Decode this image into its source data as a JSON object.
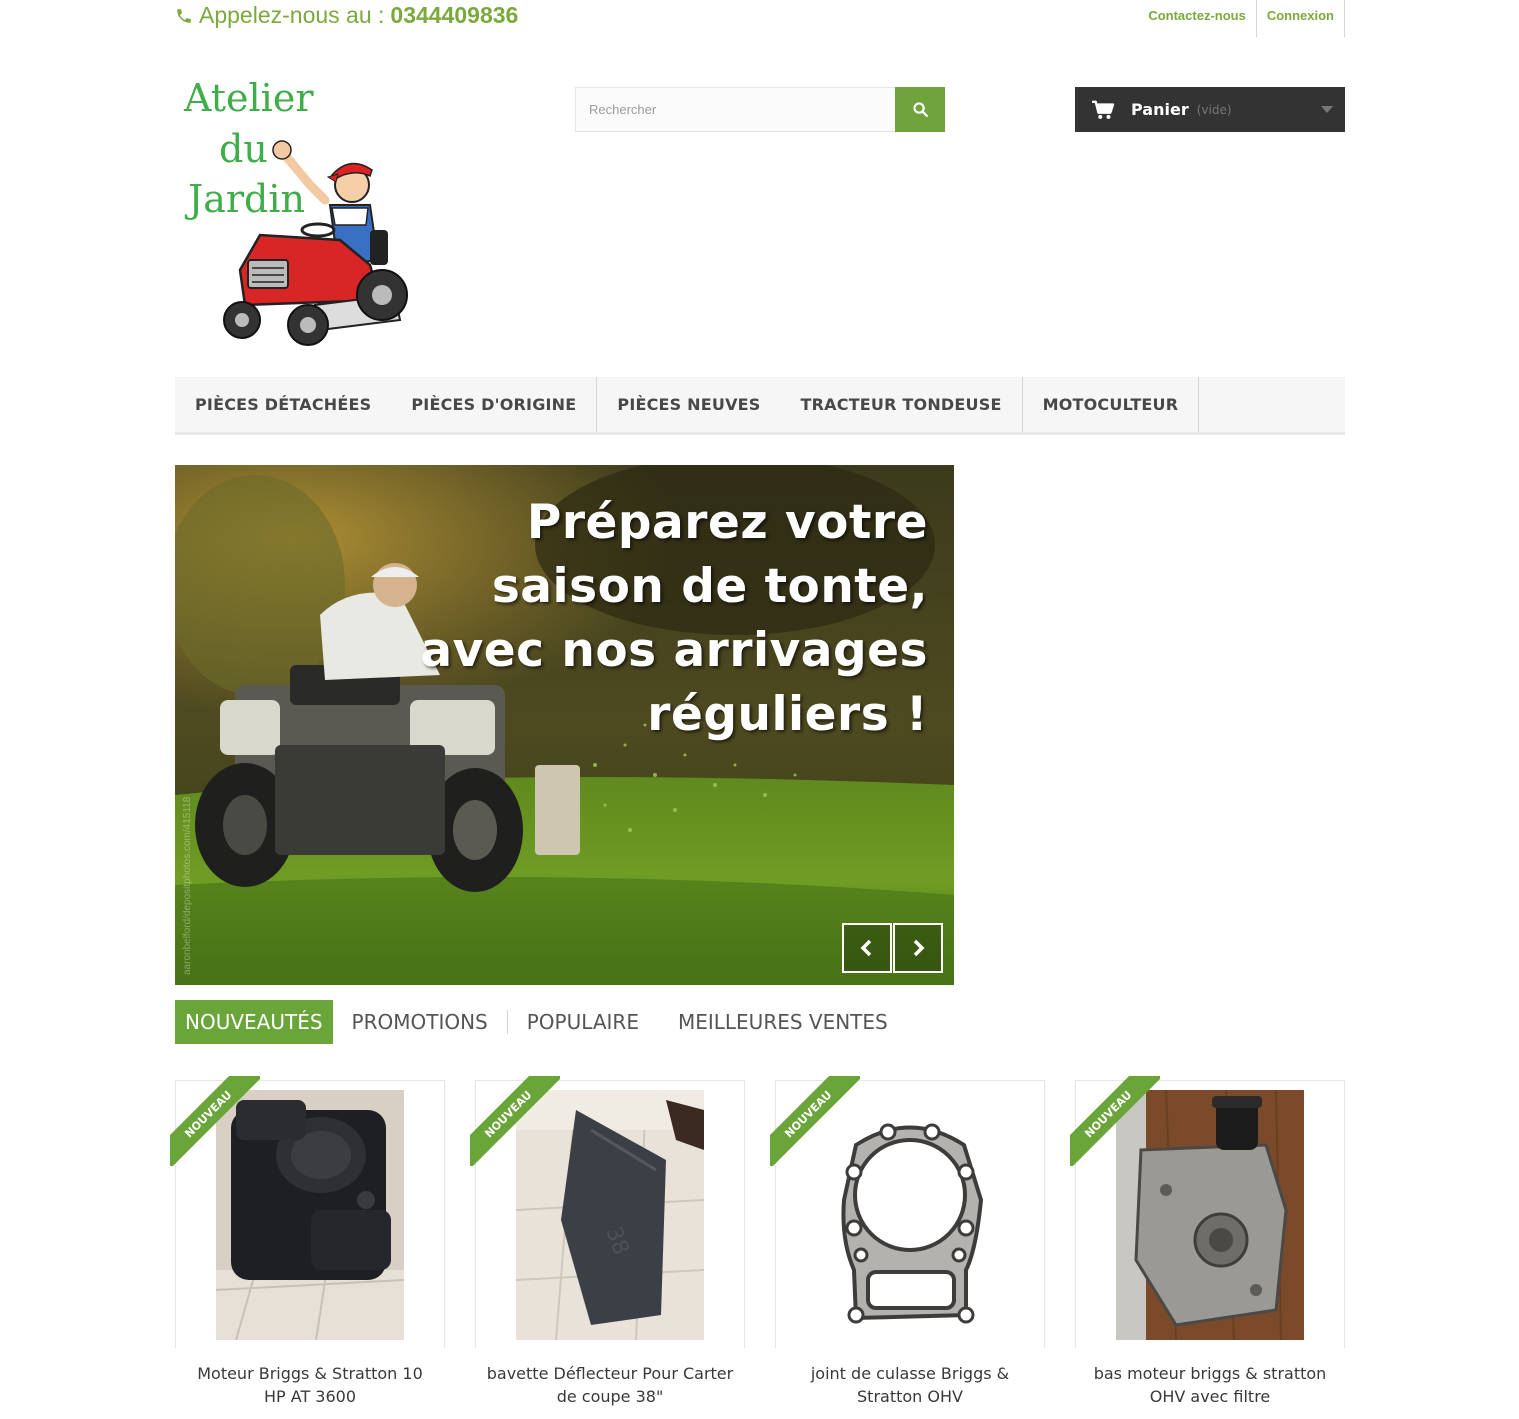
{
  "header": {
    "phone_label": "Appelez-nous au :",
    "phone_number": "0344409836",
    "contact_link": "Contactez-nous",
    "login_link": "Connexion"
  },
  "logo": {
    "line1": "Atelier",
    "line2": "du",
    "line3": "Jardin"
  },
  "search": {
    "placeholder": "Rechercher"
  },
  "cart": {
    "label": "Panier",
    "status": "(vide)"
  },
  "nav": {
    "items": [
      {
        "label": "PIÈCES DÉTACHÉES"
      },
      {
        "label": "PIÈCES D'ORIGINE"
      },
      {
        "label": "PIÈCES NEUVES"
      },
      {
        "label": "TRACTEUR TONDEUSE"
      },
      {
        "label": "MOTOCULTEUR"
      }
    ]
  },
  "slider": {
    "line1": "Préparez votre",
    "line2": "saison de tonte,",
    "line3": "avec nos arrivages",
    "line4": "réguliers !",
    "watermark": "aaronbelford/depositphotos.com/415118"
  },
  "tabs": {
    "items": [
      {
        "label": "NOUVEAUTÉS"
      },
      {
        "label": "PROMOTIONS"
      },
      {
        "label": "POPULAIRE"
      },
      {
        "label": "MEILLEURES VENTES"
      }
    ]
  },
  "products": {
    "badge": "NOUVEAU",
    "items": [
      {
        "name": "Moteur Briggs & Stratton 10 HP AT 3600"
      },
      {
        "name": "bavette Déflecteur Pour Carter de coupe 38\""
      },
      {
        "name": "joint de culasse Briggs & Stratton OHV"
      },
      {
        "name": "bas moteur briggs & stratton OHV avec filtre"
      }
    ]
  },
  "colors": {
    "accent": "#6aa53a",
    "phone": "#7aa93c",
    "logo_text": "#3fae49",
    "cart_bg": "#333333"
  }
}
